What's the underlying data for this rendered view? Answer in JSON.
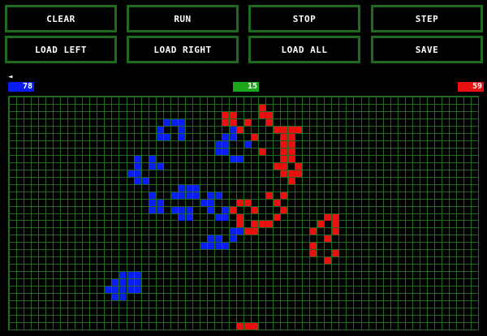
{
  "buttons": [
    "CLEAR",
    "RUN",
    "STOP",
    "STEP",
    "LOAD LEFT",
    "LOAD RIGHT",
    "LOAD ALL",
    "SAVE"
  ],
  "scores": {
    "left": "78",
    "middle": "15",
    "right": "59"
  },
  "left_marker": "◄",
  "colors": {
    "blue": "#0a1cf0",
    "red": "#e81010",
    "green_grid": "#1f6a1f",
    "green_score": "#1aa81a"
  },
  "board": {
    "cols": 64,
    "rows": 32,
    "blue": [
      [
        21,
        3
      ],
      [
        22,
        3
      ],
      [
        23,
        3
      ],
      [
        20,
        4
      ],
      [
        23,
        4
      ],
      [
        20,
        5
      ],
      [
        21,
        5
      ],
      [
        23,
        5
      ],
      [
        30,
        4
      ],
      [
        31,
        4
      ],
      [
        29,
        5
      ],
      [
        30,
        5
      ],
      [
        28,
        6
      ],
      [
        29,
        6
      ],
      [
        32,
        6
      ],
      [
        28,
        7
      ],
      [
        29,
        7
      ],
      [
        30,
        8
      ],
      [
        31,
        8
      ],
      [
        17,
        8
      ],
      [
        19,
        8
      ],
      [
        17,
        9
      ],
      [
        19,
        9
      ],
      [
        20,
        9
      ],
      [
        16,
        10
      ],
      [
        17,
        10
      ],
      [
        17,
        11
      ],
      [
        18,
        11
      ],
      [
        23,
        12
      ],
      [
        24,
        12
      ],
      [
        25,
        12
      ],
      [
        22,
        13
      ],
      [
        23,
        13
      ],
      [
        24,
        13
      ],
      [
        25,
        13
      ],
      [
        27,
        13
      ],
      [
        28,
        13
      ],
      [
        19,
        13
      ],
      [
        19,
        14
      ],
      [
        20,
        14
      ],
      [
        26,
        14
      ],
      [
        27,
        14
      ],
      [
        19,
        15
      ],
      [
        20,
        15
      ],
      [
        22,
        15
      ],
      [
        23,
        15
      ],
      [
        24,
        15
      ],
      [
        27,
        15
      ],
      [
        29,
        15
      ],
      [
        23,
        16
      ],
      [
        24,
        16
      ],
      [
        28,
        16
      ],
      [
        29,
        16
      ],
      [
        30,
        18
      ],
      [
        31,
        18
      ],
      [
        27,
        19
      ],
      [
        28,
        19
      ],
      [
        30,
        19
      ],
      [
        26,
        20
      ],
      [
        27,
        20
      ],
      [
        28,
        20
      ],
      [
        29,
        20
      ],
      [
        15,
        24
      ],
      [
        16,
        24
      ],
      [
        17,
        24
      ],
      [
        14,
        25
      ],
      [
        15,
        25
      ],
      [
        16,
        25
      ],
      [
        17,
        25
      ],
      [
        13,
        26
      ],
      [
        14,
        26
      ],
      [
        15,
        26
      ],
      [
        16,
        26
      ],
      [
        17,
        26
      ],
      [
        14,
        27
      ],
      [
        15,
        27
      ]
    ],
    "red": [
      [
        34,
        1
      ],
      [
        29,
        2
      ],
      [
        30,
        2
      ],
      [
        34,
        2
      ],
      [
        35,
        2
      ],
      [
        29,
        3
      ],
      [
        30,
        3
      ],
      [
        32,
        3
      ],
      [
        35,
        3
      ],
      [
        31,
        4
      ],
      [
        36,
        4
      ],
      [
        37,
        4
      ],
      [
        38,
        4
      ],
      [
        39,
        4
      ],
      [
        33,
        5
      ],
      [
        37,
        5
      ],
      [
        38,
        5
      ],
      [
        37,
        6
      ],
      [
        38,
        6
      ],
      [
        34,
        7
      ],
      [
        37,
        7
      ],
      [
        38,
        7
      ],
      [
        37,
        8
      ],
      [
        38,
        8
      ],
      [
        36,
        9
      ],
      [
        37,
        9
      ],
      [
        39,
        9
      ],
      [
        37,
        10
      ],
      [
        38,
        10
      ],
      [
        39,
        10
      ],
      [
        38,
        11
      ],
      [
        35,
        13
      ],
      [
        37,
        13
      ],
      [
        31,
        14
      ],
      [
        32,
        14
      ],
      [
        36,
        14
      ],
      [
        30,
        15
      ],
      [
        33,
        15
      ],
      [
        37,
        15
      ],
      [
        31,
        16
      ],
      [
        36,
        16
      ],
      [
        31,
        17
      ],
      [
        33,
        17
      ],
      [
        34,
        17
      ],
      [
        35,
        17
      ],
      [
        32,
        18
      ],
      [
        33,
        18
      ],
      [
        43,
        16
      ],
      [
        44,
        16
      ],
      [
        42,
        17
      ],
      [
        44,
        17
      ],
      [
        41,
        18
      ],
      [
        44,
        18
      ],
      [
        43,
        19
      ],
      [
        41,
        20
      ],
      [
        41,
        21
      ],
      [
        44,
        21
      ],
      [
        43,
        22
      ],
      [
        31,
        31
      ],
      [
        32,
        31
      ],
      [
        33,
        31
      ]
    ]
  }
}
